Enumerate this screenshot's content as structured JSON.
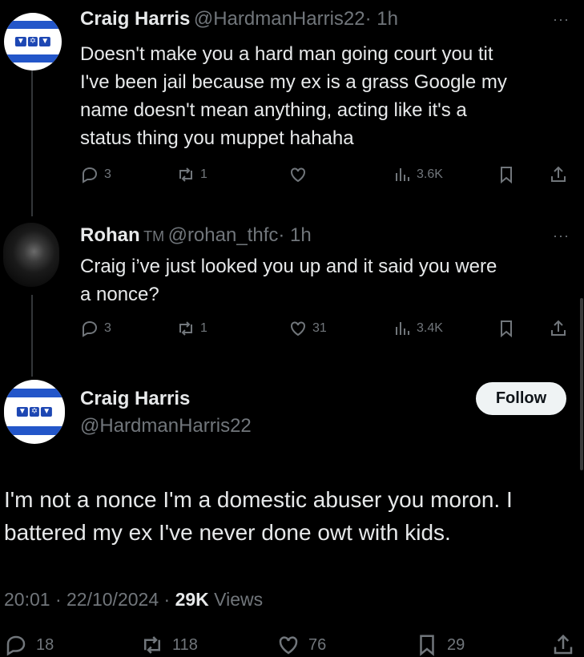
{
  "tweets": [
    {
      "name": "Craig Harris",
      "handle": "@HardmanHarris22",
      "time": "· 1h",
      "text_lines": [
        "Doesn't make you a hard man going court you tit",
        "I've been jail because my ex is a grass Google my",
        "name doesn't mean anything, acting like it's a",
        "status thing you muppet hahaha"
      ],
      "replies": "3",
      "reposts": "1",
      "likes": "",
      "views": "3.6K",
      "avatar": "flag-avatar"
    },
    {
      "name": "Rohan",
      "badge": "TM",
      "handle": "@rohan_thfc",
      "time": "· 1h",
      "text_lines": [
        "Craig i’ve just looked you up and it said you were",
        "a nonce?"
      ],
      "replies": "3",
      "reposts": "1",
      "likes": "31",
      "views": "3.4K",
      "avatar": "photo-avatar"
    }
  ],
  "main_tweet": {
    "name": "Craig Harris",
    "handle": "@HardmanHarris22",
    "follow_label": "Follow",
    "text_lines": [
      "I'm not a nonce I'm a domestic abuser you moron. I",
      "battered my ex I've never done owt with kids."
    ],
    "timestamp": "20:01 · 22/10/2024 · ",
    "views_count": "29K",
    "views_label": " Views",
    "replies": "18",
    "reposts": "118",
    "likes": "76",
    "bookmarks": "29"
  },
  "icons": {
    "more": "more-icon",
    "reply": "reply-icon",
    "repost": "repost-icon",
    "like": "heart-icon",
    "views": "views-icon",
    "bookmark": "bookmark-icon",
    "share": "share-icon"
  },
  "colors": {
    "background": "#000000",
    "text": "#e7e9ea",
    "secondary": "#71767b",
    "flag_blue": "#2356c9"
  },
  "more_glyph": "···"
}
